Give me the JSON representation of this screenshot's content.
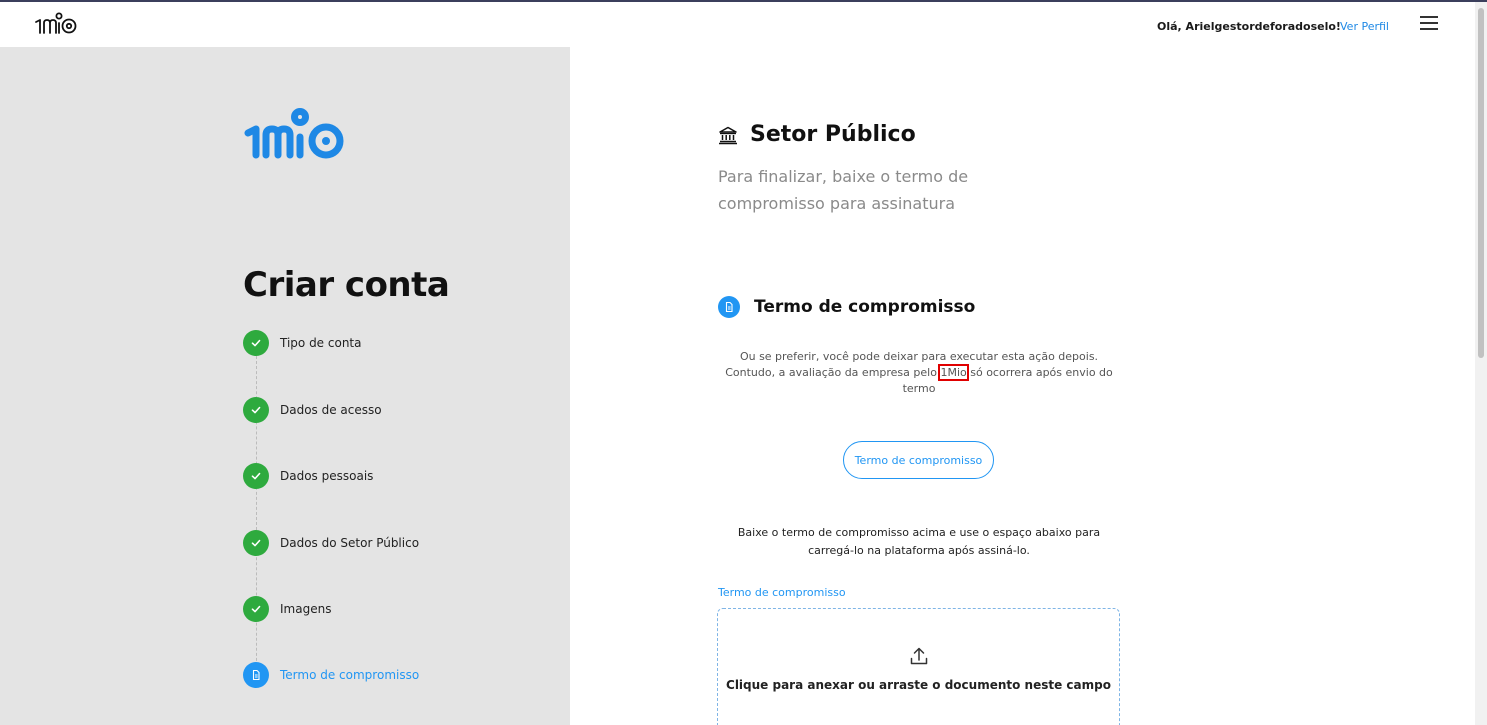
{
  "header": {
    "greeting": "Olá, Arielgestordeforadoselo!",
    "profile_link": "Ver Perfil",
    "menu_icon": "hamburger-menu-icon"
  },
  "brand": {
    "logo_text": "1MIO",
    "color": "#1e88e5"
  },
  "left_panel": {
    "title": "Criar conta",
    "steps": [
      {
        "label": "Tipo de conta",
        "status": "done"
      },
      {
        "label": "Dados de acesso",
        "status": "done"
      },
      {
        "label": "Dados pessoais",
        "status": "done"
      },
      {
        "label": "Dados do Setor Público",
        "status": "done"
      },
      {
        "label": "Imagens",
        "status": "done"
      },
      {
        "label": "Termo de compromisso",
        "status": "active"
      }
    ]
  },
  "main": {
    "sector_title": "Setor Público",
    "sector_icon": "bank-icon",
    "subtitle": "Para finalizar, baixe o termo de compromisso para assinatura",
    "section_title": "Termo de compromisso",
    "section_icon": "document-icon",
    "note_before": "Ou se preferir, você pode deixar para executar esta ação depois. Contudo, a avaliação da empresa pelo ",
    "note_highlight": "1Mio",
    "note_after": " só ocorrera após envio do termo",
    "download_button": "Termo de compromisso",
    "instructions": "Baixe o termo de compromisso acima e use o espaço abaixo para carregá-lo na plataforma após assiná-lo.",
    "upload_label": "Termo de compromisso",
    "upload_text": "Clique para anexar ou arraste o documento neste campo",
    "upload_icon": "upload-icon"
  },
  "colors": {
    "accent": "#2196f3",
    "success": "#2eaa3e",
    "left_bg": "#e4e4e4",
    "highlight_box": "#e00000"
  }
}
